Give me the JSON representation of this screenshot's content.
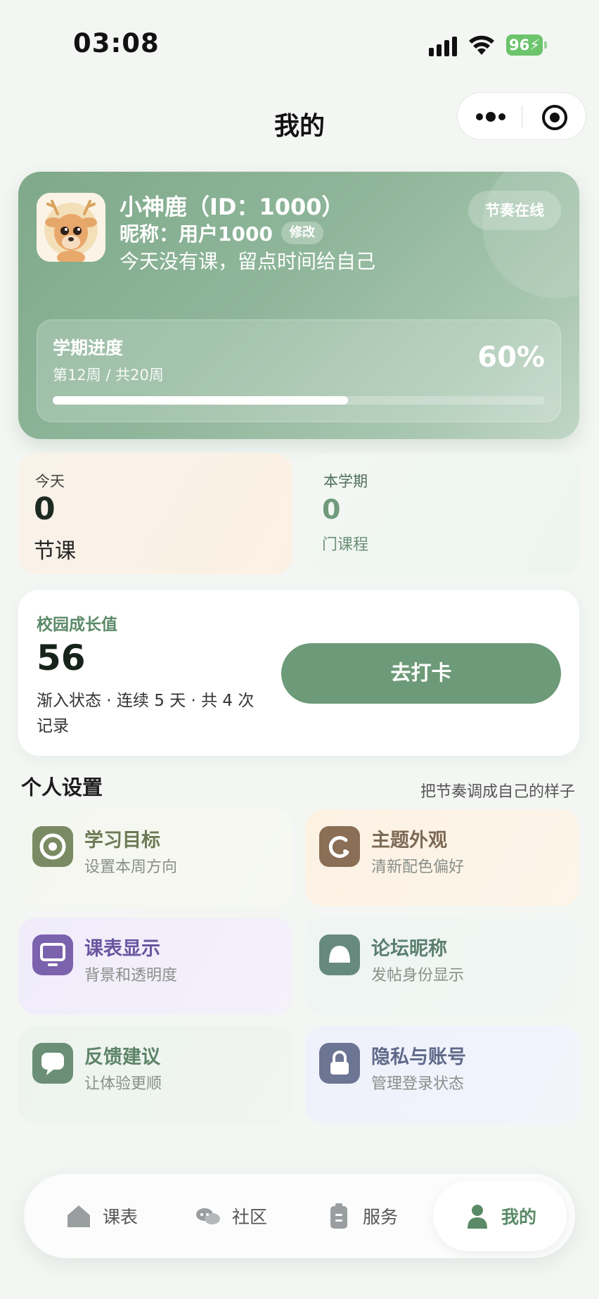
{
  "status_bar": {
    "time": "03:08",
    "battery": "96"
  },
  "nav": {
    "title": "我的"
  },
  "profile": {
    "name": "小神鹿（ID：1000）",
    "nickname_label": "昵称：",
    "nickname": "用户1000",
    "edit_label": "修改",
    "motto": "今天没有课，留点时间给自己",
    "online_badge": "节奏在线",
    "semester": {
      "title": "学期进度",
      "week_text": "第12周 / 共20周",
      "percent_text": "60%",
      "progress_fraction": 0.6
    }
  },
  "stats": {
    "today": {
      "label": "今天",
      "value": "0",
      "unit": "节课"
    },
    "semester": {
      "label": "本学期",
      "value": "0",
      "unit": "门课程"
    }
  },
  "growth": {
    "label": "校园成长值",
    "value": "56",
    "desc": "渐入状态 · 连续 5 天 · 共 4 次记录",
    "button": "去打卡"
  },
  "settings": {
    "title": "个人设置",
    "subtitle": "把节奏调成自己的样子",
    "items": [
      {
        "title": "学习目标",
        "sub": "设置本周方向",
        "icon": "target-icon"
      },
      {
        "title": "主题外观",
        "sub": "清新配色偏好",
        "icon": "palette-icon"
      },
      {
        "title": "课表显示",
        "sub": "背景和透明度",
        "icon": "monitor-icon"
      },
      {
        "title": "论坛昵称",
        "sub": "发帖身份显示",
        "icon": "user-icon"
      },
      {
        "title": "反馈建议",
        "sub": "让体验更顺",
        "icon": "chat-icon"
      },
      {
        "title": "隐私与账号",
        "sub": "管理登录状态",
        "icon": "lock-icon"
      }
    ]
  },
  "tabbar": {
    "items": [
      {
        "label": "课表",
        "icon": "home-icon"
      },
      {
        "label": "社区",
        "icon": "community-icon"
      },
      {
        "label": "服务",
        "icon": "clipboard-icon"
      },
      {
        "label": "我的",
        "icon": "profile-icon"
      }
    ],
    "active_index": 3
  },
  "colors": {
    "accent": "#6d9a78",
    "card_green": "#8fb69a",
    "battery": "#6cc46b"
  }
}
